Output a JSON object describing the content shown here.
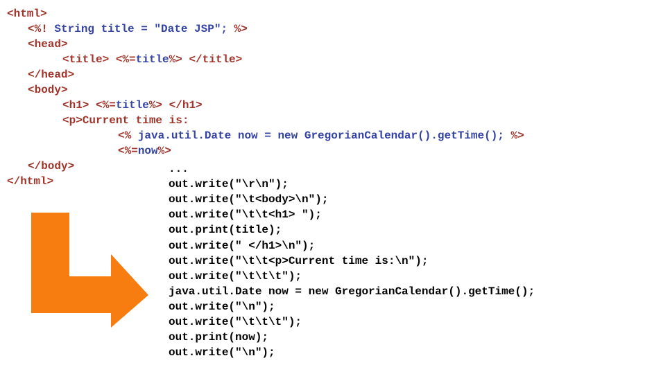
{
  "colors": {
    "tag": "#a0342a",
    "java": "#3342a5",
    "output": "#000000",
    "arrow": "#f77d11"
  },
  "icons": {
    "arrow": "orange-l-shaped-arrow-icon"
  },
  "jsp_source": {
    "lines": [
      [
        {
          "t": "<html>",
          "c": "tag"
        }
      ],
      [
        {
          "t": "<%! ",
          "c": "tag"
        },
        {
          "t": "String title = \"Date JSP\"; ",
          "c": "java"
        },
        {
          "t": "%>",
          "c": "tag"
        }
      ],
      [
        {
          "t": "<head>",
          "c": "tag"
        }
      ],
      [
        {
          "t": "<title> <%=",
          "c": "tag"
        },
        {
          "t": "title",
          "c": "java"
        },
        {
          "t": "%> </title>",
          "c": "tag"
        }
      ],
      [
        {
          "t": "</head>",
          "c": "tag"
        }
      ],
      [
        {
          "t": "<body>",
          "c": "tag"
        }
      ],
      [
        {
          "t": "<h1> <%=",
          "c": "tag"
        },
        {
          "t": "title",
          "c": "java"
        },
        {
          "t": "%> </h1>",
          "c": "tag"
        }
      ],
      [
        {
          "t": "<p>Current time is:",
          "c": "tag"
        }
      ],
      [
        {
          "t": "<% ",
          "c": "tag"
        },
        {
          "t": "java.util.Date now = new GregorianCalendar().getTime(); ",
          "c": "java"
        },
        {
          "t": "%>",
          "c": "tag"
        }
      ],
      [
        {
          "t": "<%=",
          "c": "tag"
        },
        {
          "t": "now",
          "c": "java"
        },
        {
          "t": "%>",
          "c": "tag"
        }
      ],
      [
        {
          "t": "</body>",
          "c": "tag"
        }
      ],
      [
        {
          "t": "</html>",
          "c": "tag"
        }
      ]
    ]
  },
  "generated_code": {
    "lines": [
      "...",
      "out.write(\"\\r\\n\");",
      "out.write(\"\\t<body>\\n\");",
      "out.write(\"\\t\\t<h1> \");",
      "out.print(title);",
      "out.write(\" </h1>\\n\");",
      "out.write(\"\\t\\t<p>Current time is:\\n\");",
      "out.write(\"\\t\\t\\t\");",
      "java.util.Date now = new GregorianCalendar().getTime();",
      "out.write(\"\\n\");",
      "out.write(\"\\t\\t\\t\");",
      "out.print(now);",
      "out.write(\"\\n\");"
    ]
  }
}
